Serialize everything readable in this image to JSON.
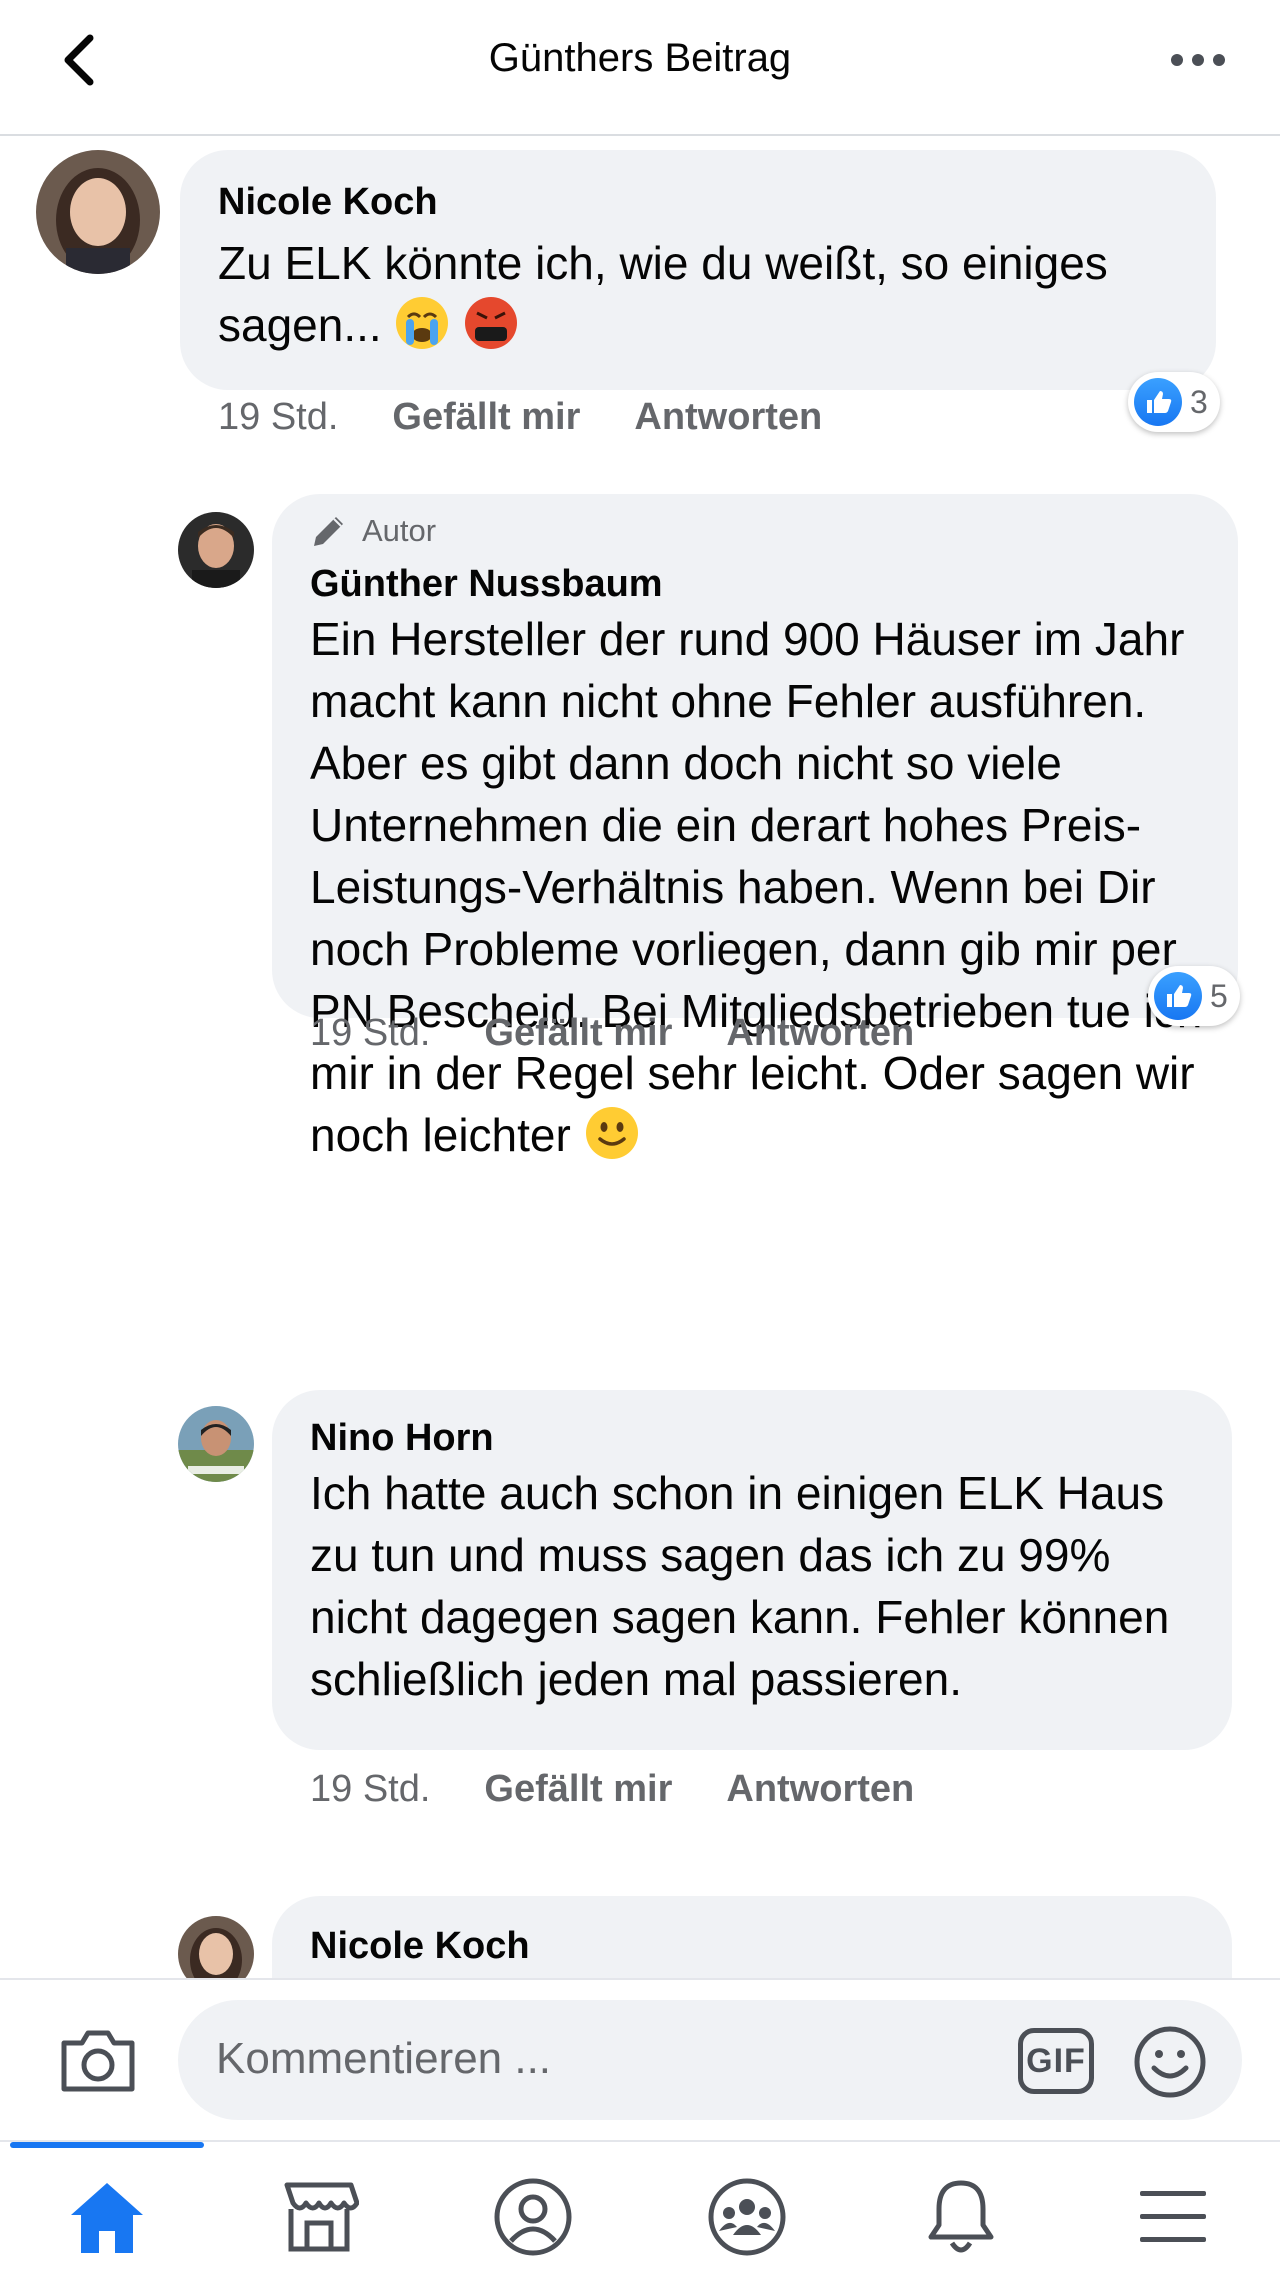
{
  "header": {
    "title": "Günthers Beitrag",
    "back_icon": "chevron-left-icon",
    "more_icon": "more-horizontal-icon"
  },
  "comments": [
    {
      "name": "Nicole Koch",
      "text": "Zu ELK könnte ich, wie du weißt, so einiges sagen... ",
      "emojis": [
        "crying-face-emoji",
        "cursing-face-emoji"
      ],
      "time": "19 Std.",
      "like_label": "Gefällt mir",
      "reply_label": "Antworten",
      "reaction_count": "3"
    },
    {
      "badge": "Autor",
      "name": "Günther Nussbaum",
      "text": "Ein Hersteller der rund 900 Häuser im Jahr macht kann nicht ohne Fehler ausführen. Aber es gibt dann doch nicht so viele Unternehmen die ein derart hohes Preis-Leistungs-Verhältnis haben. Wenn bei Dir noch Probleme vorliegen, dann gib mir per PN Bescheid. Bei Mitgliedsbetrieben tue ich mir in der Regel sehr leicht. Oder sagen wir noch leichter ",
      "emojis": [
        "slightly-smiling-face-emoji"
      ],
      "time": "19 Std.",
      "like_label": "Gefällt mir",
      "reply_label": "Antworten",
      "reaction_count": "5"
    },
    {
      "name": "Nino Horn",
      "text": "Ich hatte auch schon in einigen ELK Haus zu tun und muss sagen das ich zu 99% nicht dagegen sagen kann. Fehler können schließlich jeden mal passieren.",
      "time": "19 Std.",
      "like_label": "Gefällt mir",
      "reply_label": "Antworten"
    },
    {
      "name": "Nicole Koch"
    }
  ],
  "composer": {
    "placeholder": "Kommentieren ...",
    "gif_label": "GIF"
  },
  "tabbar": {
    "active_tab": "home",
    "tabs": [
      "home-icon",
      "marketplace-icon",
      "profile-icon",
      "groups-icon",
      "notifications-icon",
      "menu-icon"
    ]
  },
  "colors": {
    "accent": "#1877f2",
    "bubble": "#f0f2f5",
    "secondary_text": "#65676b"
  }
}
